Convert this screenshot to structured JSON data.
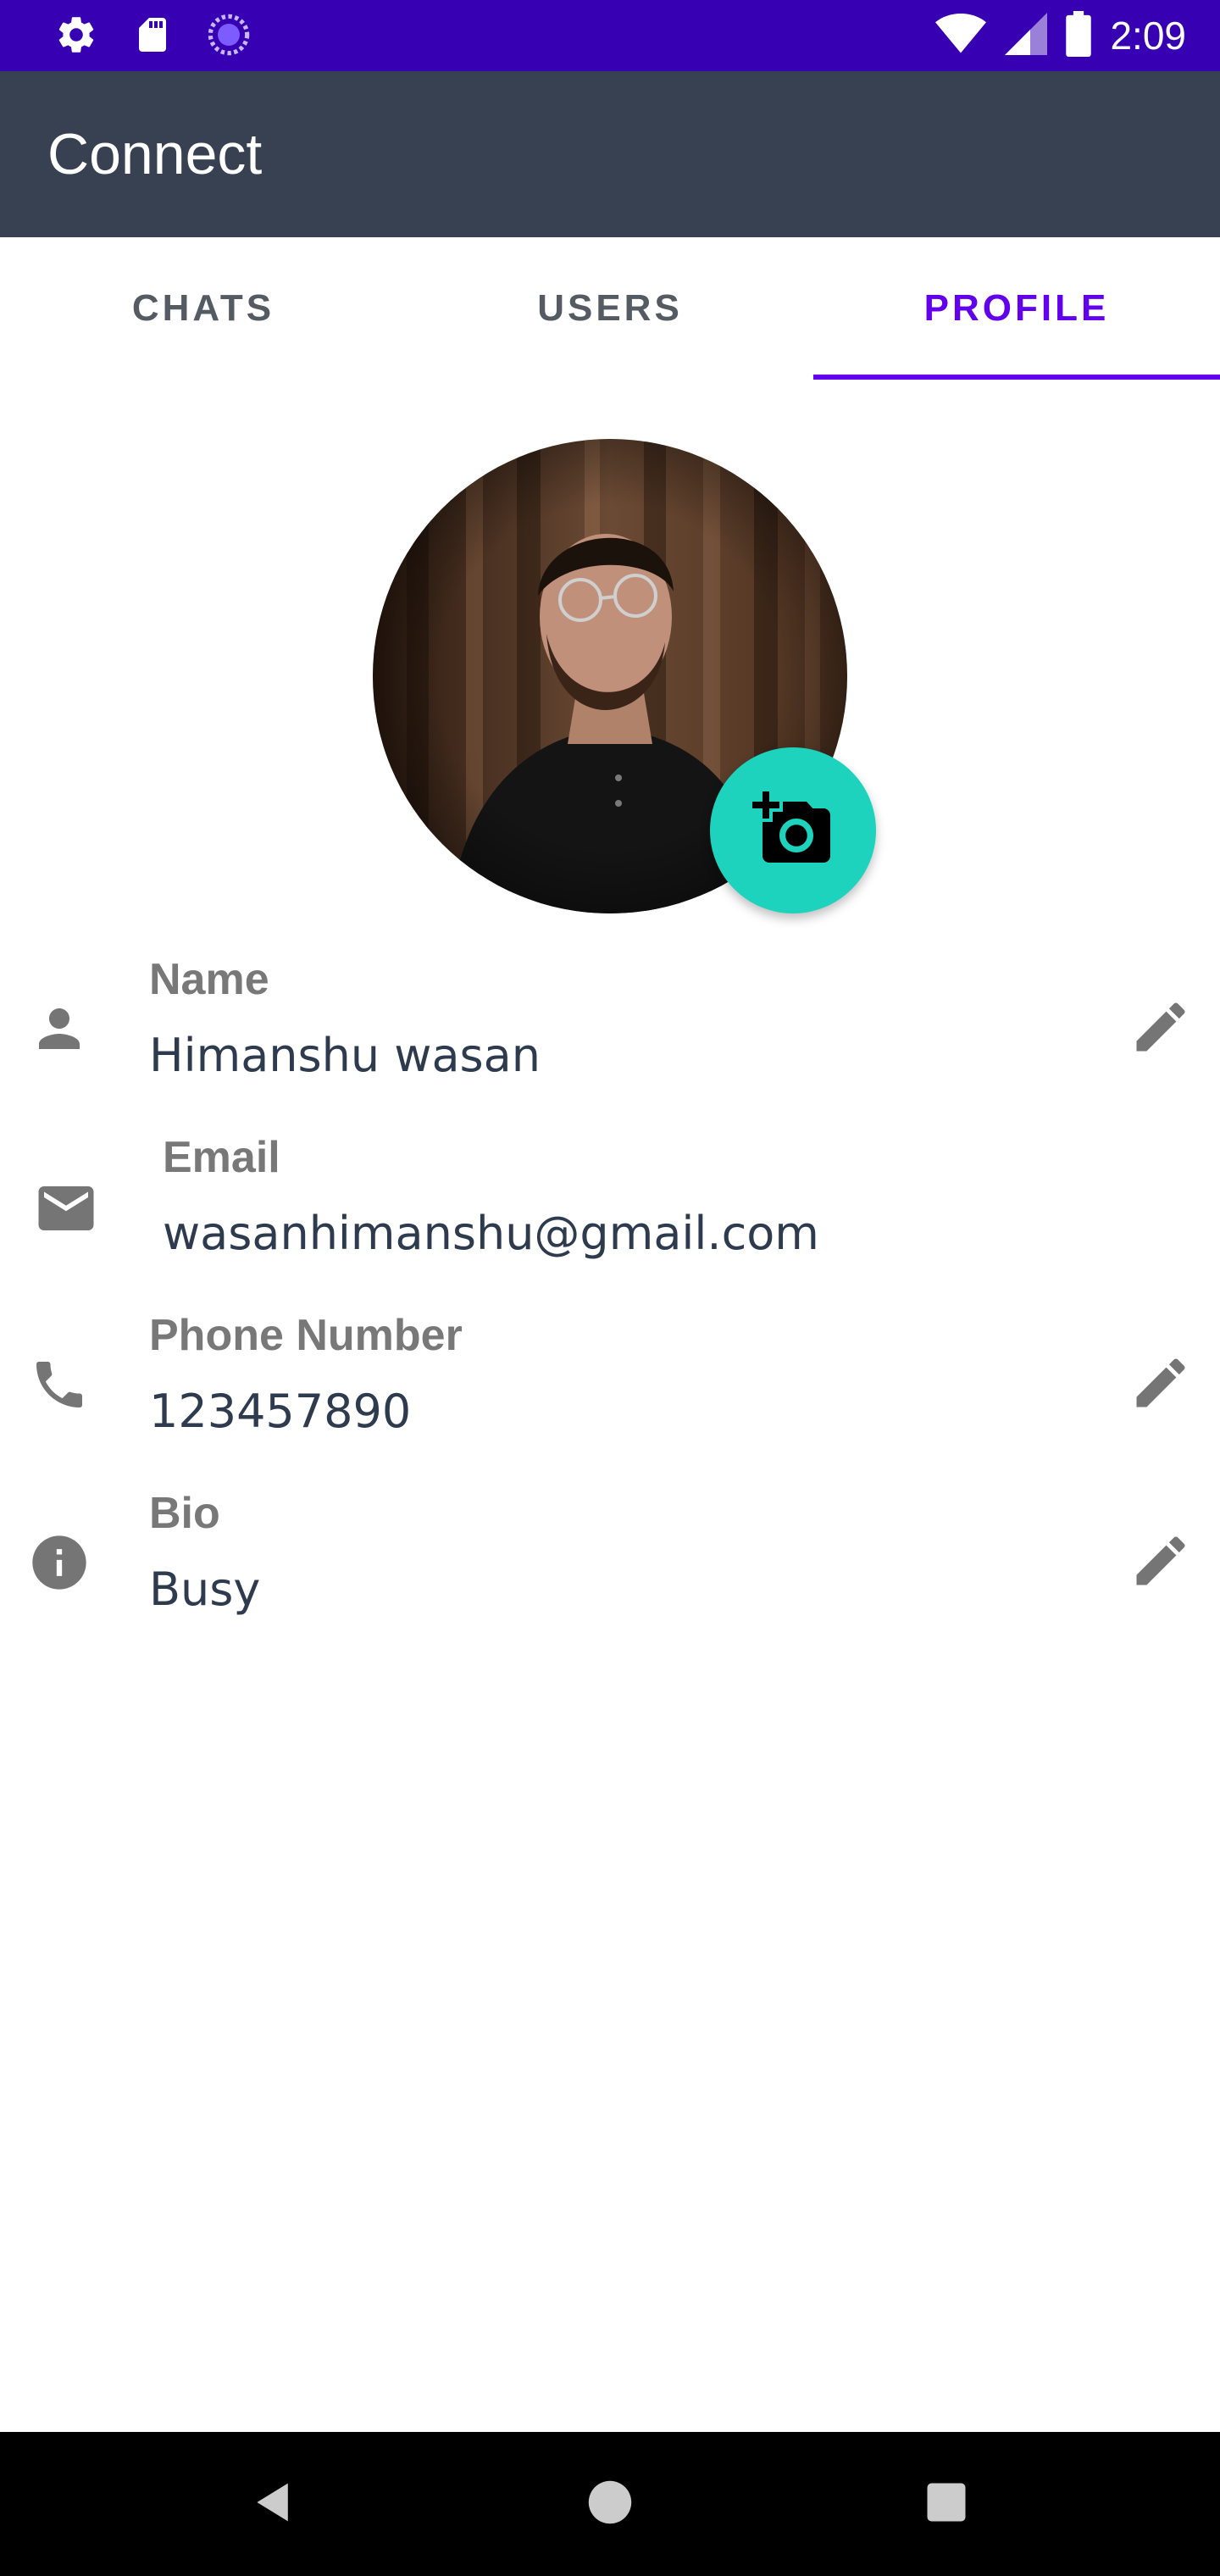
{
  "status_bar": {
    "time": "2:09",
    "icons_left": [
      "settings-icon",
      "sd-card-icon",
      "sync-icon"
    ],
    "icons_right": [
      "wifi-icon",
      "signal-icon",
      "battery-icon"
    ]
  },
  "app_bar": {
    "title": "Connect"
  },
  "tabs": [
    {
      "label": "CHATS",
      "active": false
    },
    {
      "label": "USERS",
      "active": false
    },
    {
      "label": "PROFILE",
      "active": true
    }
  ],
  "profile": {
    "avatar": "profile-photo",
    "fab_icon": "add-a-photo-icon",
    "fields": [
      {
        "label": "Name",
        "value": "Himanshu wasan",
        "icon": "person-icon",
        "editable": true
      },
      {
        "label": "Email",
        "value": "wasanhimanshu@gmail.com",
        "icon": "email-icon",
        "editable": false
      },
      {
        "label": "Phone Number",
        "value": "123457890",
        "icon": "phone-icon",
        "editable": true
      },
      {
        "label": "Bio",
        "value": "Busy",
        "icon": "info-icon",
        "editable": true
      }
    ]
  },
  "colors": {
    "status_bar": "#3700b3",
    "app_bar": "#374151",
    "accent": "#6200ee",
    "fab": "#1dd3bd",
    "icon_gray": "#757575"
  },
  "nav_bar": {
    "buttons": [
      "back-icon",
      "home-icon",
      "recents-icon"
    ]
  }
}
